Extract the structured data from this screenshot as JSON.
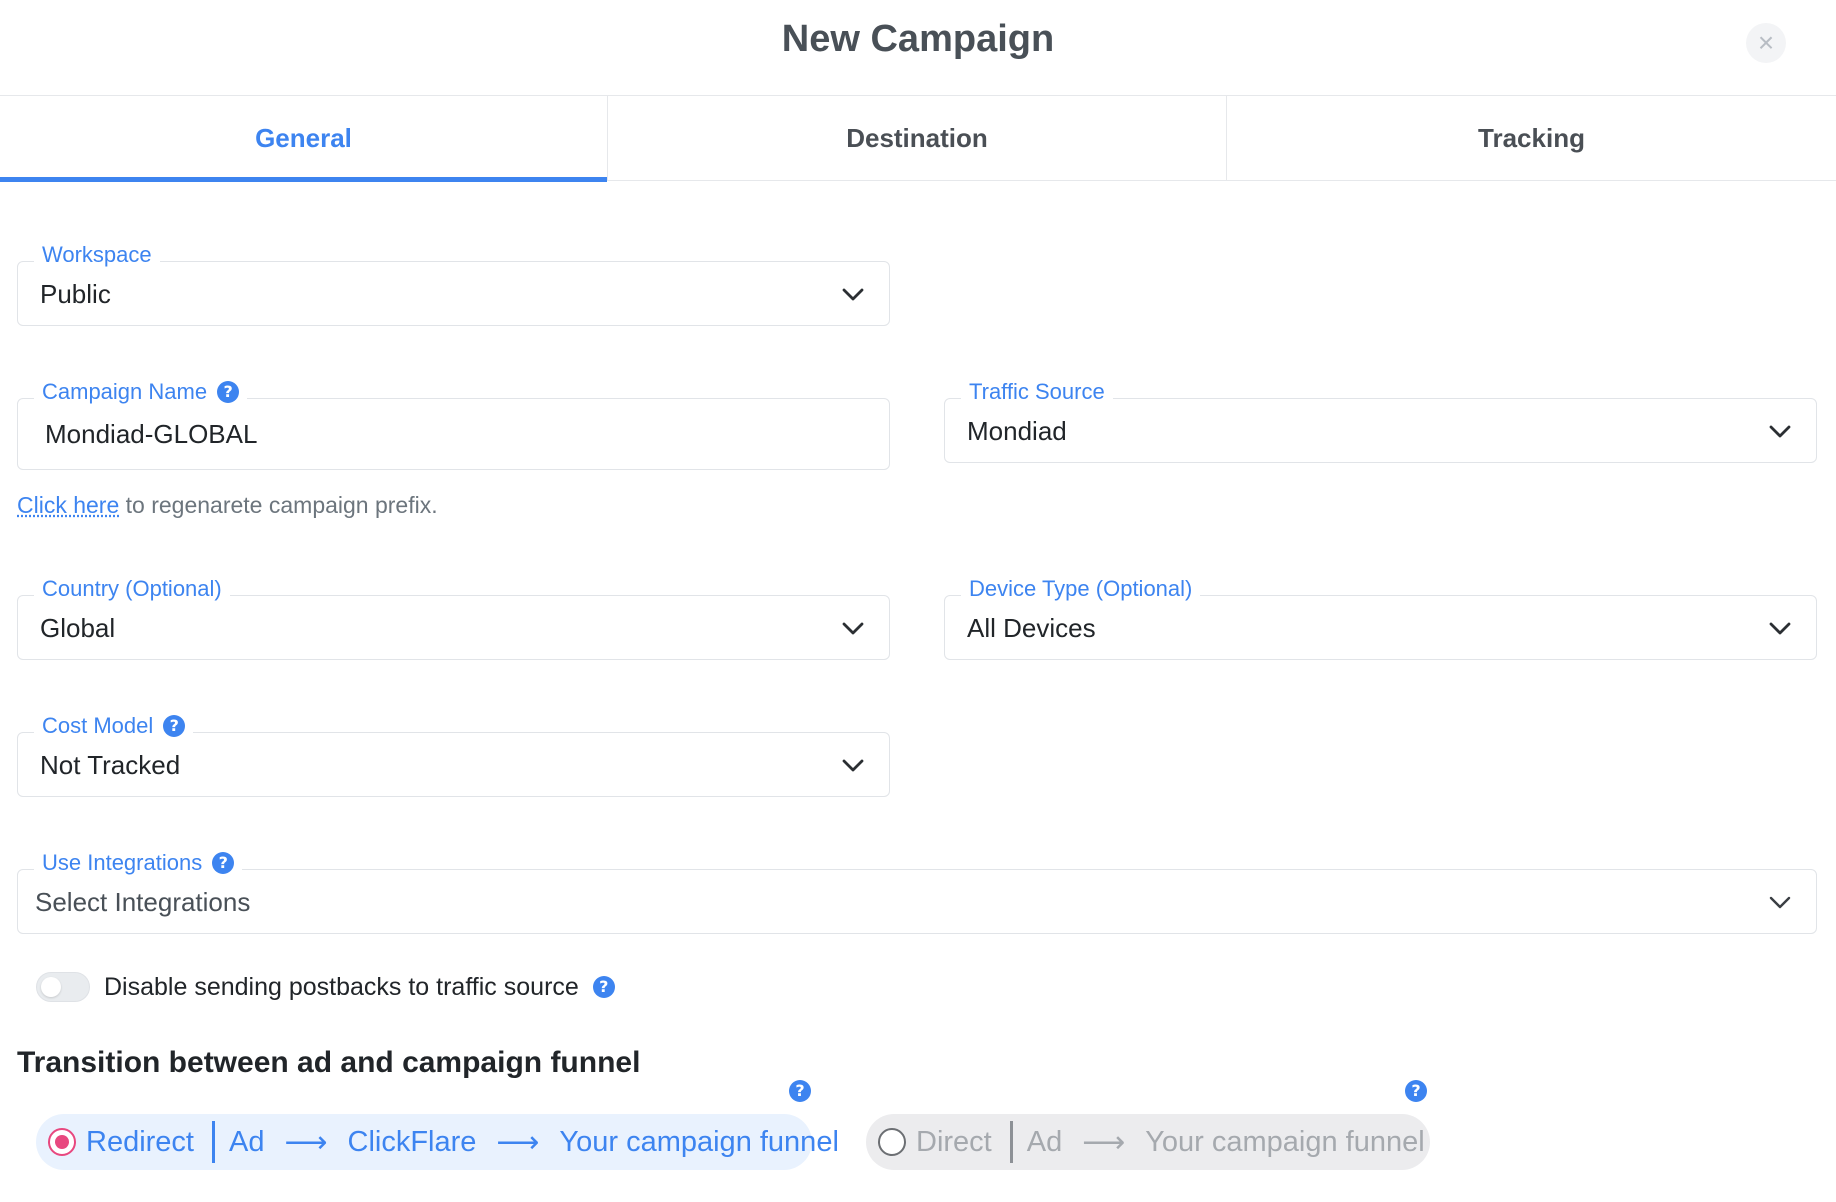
{
  "modal": {
    "title": "New Campaign",
    "close_label": "×"
  },
  "tabs": [
    {
      "label": "General",
      "active": true
    },
    {
      "label": "Destination",
      "active": false
    },
    {
      "label": "Tracking",
      "active": false
    }
  ],
  "fields": {
    "workspace": {
      "label": "Workspace",
      "value": "Public"
    },
    "campaign_name": {
      "label": "Campaign Name",
      "value": "Mondiad-GLOBAL"
    },
    "traffic_source": {
      "label": "Traffic Source",
      "value": "Mondiad"
    },
    "country": {
      "label": "Country (Optional)",
      "value": "Global"
    },
    "device_type": {
      "label": "Device Type (Optional)",
      "value": "All Devices"
    },
    "cost_model": {
      "label": "Cost Model",
      "value": "Not Tracked"
    },
    "integrations": {
      "label": "Use Integrations",
      "placeholder": "Select Integrations"
    }
  },
  "regenerate": {
    "link": "Click here",
    "text": " to regenarete campaign prefix."
  },
  "postbacks_toggle": {
    "label": "Disable sending postbacks to traffic source",
    "enabled": false
  },
  "transition": {
    "title": "Transition between ad and campaign funnel",
    "options": [
      {
        "label": "Redirect",
        "steps": [
          "Ad",
          "ClickFlare",
          "Your campaign funnel"
        ],
        "selected": true
      },
      {
        "label": "Direct",
        "steps": [
          "Ad",
          "Your campaign funnel"
        ],
        "selected": false
      }
    ]
  },
  "icons": {
    "help": "?",
    "arrow": "⟶",
    "chevron": "chevron-down-icon",
    "close": "close-icon"
  },
  "colors": {
    "accent": "#3d84f0",
    "radio_selected": "#e8487f"
  }
}
